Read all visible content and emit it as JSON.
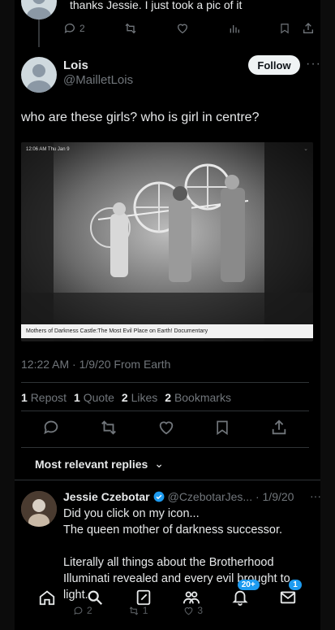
{
  "previous_tweet": {
    "text": "thanks Jessie. I just took a pic of it",
    "actions": {
      "replies": "2",
      "retweets": "",
      "likes": "",
      "views": ""
    }
  },
  "tweet": {
    "name": "Lois",
    "handle": "@MailletLois",
    "follow_label": "Follow",
    "more_label": "···",
    "text": "who are these girls?  who is girl in centre?",
    "media": {
      "status_time": "12:06 AM   Thu Jan 9",
      "caption": "Mothers of Darkness Castle:The Most Evil Place on Earth! Documentary",
      "caption_chevron": "⌄"
    },
    "meta": "12:22 AM · 1/9/20 From Earth",
    "stats": [
      {
        "count": "1",
        "label": "Repost"
      },
      {
        "count": "1",
        "label": "Quote"
      },
      {
        "count": "2",
        "label": "Likes"
      },
      {
        "count": "2",
        "label": "Bookmarks"
      }
    ]
  },
  "sort": {
    "label": "Most relevant replies",
    "chevron": "⌄"
  },
  "reply": {
    "name": "Jessie Czebotar",
    "handle_date": "@CzebotarJes... · 1/9/20",
    "more_label": "···",
    "lines": [
      "Did you click on my icon...",
      "The queen mother of darkness successor.",
      "",
      "Literally all things about the Brotherhood",
      "Illuminati revealed and every evil brought to",
      "light."
    ],
    "actions": {
      "replies": "2",
      "retweets": "1",
      "likes": "3"
    }
  },
  "nav": {
    "communities_badge": "20+",
    "messages_badge": "1"
  },
  "colors": {
    "background": "#000000",
    "text": "#e7e9ea",
    "muted": "#71767b",
    "accent": "#1d9bf0",
    "verified": "#1d9bf0"
  }
}
